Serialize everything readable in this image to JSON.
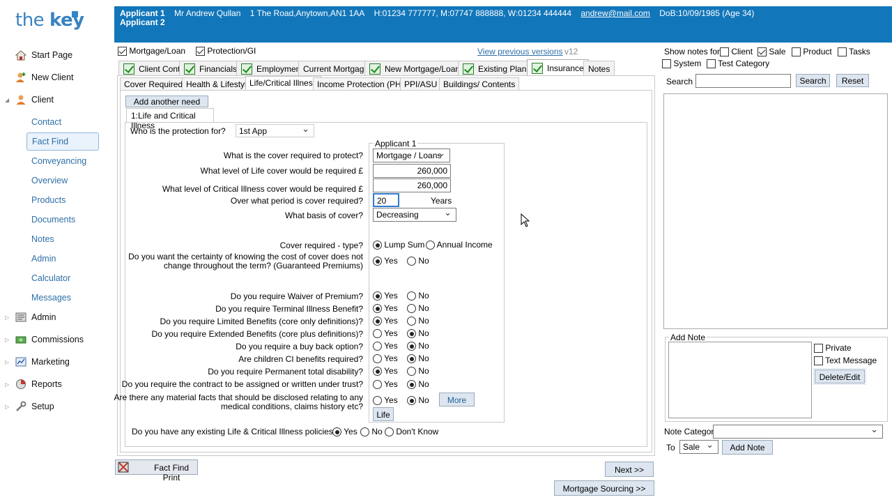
{
  "logo": {
    "text_light": "the ",
    "text_bold": "key"
  },
  "nav": {
    "start_page": "Start Page",
    "new_client": "New Client",
    "client": "Client",
    "client_sub": [
      "Contact",
      "Fact Find",
      "Conveyancing",
      "Overview",
      "Products",
      "Documents",
      "Notes",
      "Admin",
      "Calculator",
      "Messages"
    ],
    "admin": "Admin",
    "commissions": "Commissions",
    "marketing": "Marketing",
    "reports": "Reports",
    "setup": "Setup"
  },
  "header": {
    "app1_label": "Applicant 1",
    "app2_label": "Applicant 2",
    "name": "Mr Andrew  Qullan",
    "address": "1 The Road,Anytown,AN1 1AA",
    "phones": "H:01234 777777, M:07747 888888, W:01234 444444",
    "email": "andrew@mail.com",
    "dob": "DoB:10/09/1985 (Age 34)"
  },
  "top": {
    "mortgage_loan": "Mortgage/Loan",
    "protection_gi": "Protection/GI",
    "view_previous": "View previous versions",
    "version": "v12"
  },
  "tabs": [
    "Client Cont.",
    "Financials",
    "Employment",
    "Current Mortgage",
    "New Mortgage/Loan",
    "Existing Plans",
    "Insurance",
    "Notes"
  ],
  "subtabs": [
    "Cover Required",
    "Health & Lifestyle",
    "Life/Critical Illness",
    "Income Protection (PHI)",
    "PPI/ASU",
    "Buildings/ Contents"
  ],
  "form": {
    "add_need": "Add another need",
    "need_tab": "1:Life and Critical Illness",
    "who_label": "Who is the protection for?",
    "who_value": "1st App",
    "group_title": "Applicant 1",
    "q_protect": "What is the cover required to protect?",
    "protect_value": "Mortgage / Loans",
    "q_life_level": "What level of Life cover would be required £",
    "life_level": "260,000",
    "q_ci_level": "What level of Critical Illness cover would be required £",
    "ci_level": "260,000",
    "q_period": "Over what period is cover required?",
    "period": "20",
    "years": "Years",
    "q_basis": "What basis of cover?",
    "basis": "Decreasing",
    "q_type": "Cover required - type?",
    "lump_sum": "Lump Sum",
    "annual_income": "Annual Income",
    "q_guaranteed_1": "Do you want the certainty of knowing the cost of cover does not",
    "q_guaranteed_2": "change throughout the term? (Guaranteed Premiums)",
    "yes": "Yes",
    "no": "No",
    "questions": [
      "Do you require Waiver of Premium?",
      "Do you require Terminal Illness Benefit?",
      "Do you require Limited Benefits (core only definitions)?",
      "Do you require Extended Benefits (core plus definitions)?",
      "Do you require a buy back option?",
      "Are children CI benefits required?",
      "Do you require Permanent total disability?",
      "Do you require the contract to be assigned or written under trust?"
    ],
    "q_material_1": "Are there any material facts that should be disclosed relating to any",
    "q_material_2": "medical conditions, claims history etc?",
    "more": "More",
    "life": "Life",
    "q_existing": "Do you have any existing Life & Critical Illness policies?",
    "dont_know": "Don't Know"
  },
  "bottom": {
    "fact_find_print": "Fact Find Print",
    "next": "Next >>",
    "mortgage_sourcing": "Mortgage Sourcing >>"
  },
  "notes": {
    "show_for": "Show notes for",
    "client": "Client",
    "sale": "Sale",
    "product": "Product",
    "tasks": "Tasks",
    "system": "System",
    "test_category": "Test Category",
    "search_label": "Search",
    "search_btn": "Search",
    "reset_btn": "Reset",
    "add_note_title": "Add Note",
    "private": "Private",
    "text_message": "Text Message",
    "delete_edit": "Delete/Edit",
    "note_category": "Note Category",
    "to": "To",
    "to_value": "Sale",
    "add_note_btn": "Add Note"
  }
}
